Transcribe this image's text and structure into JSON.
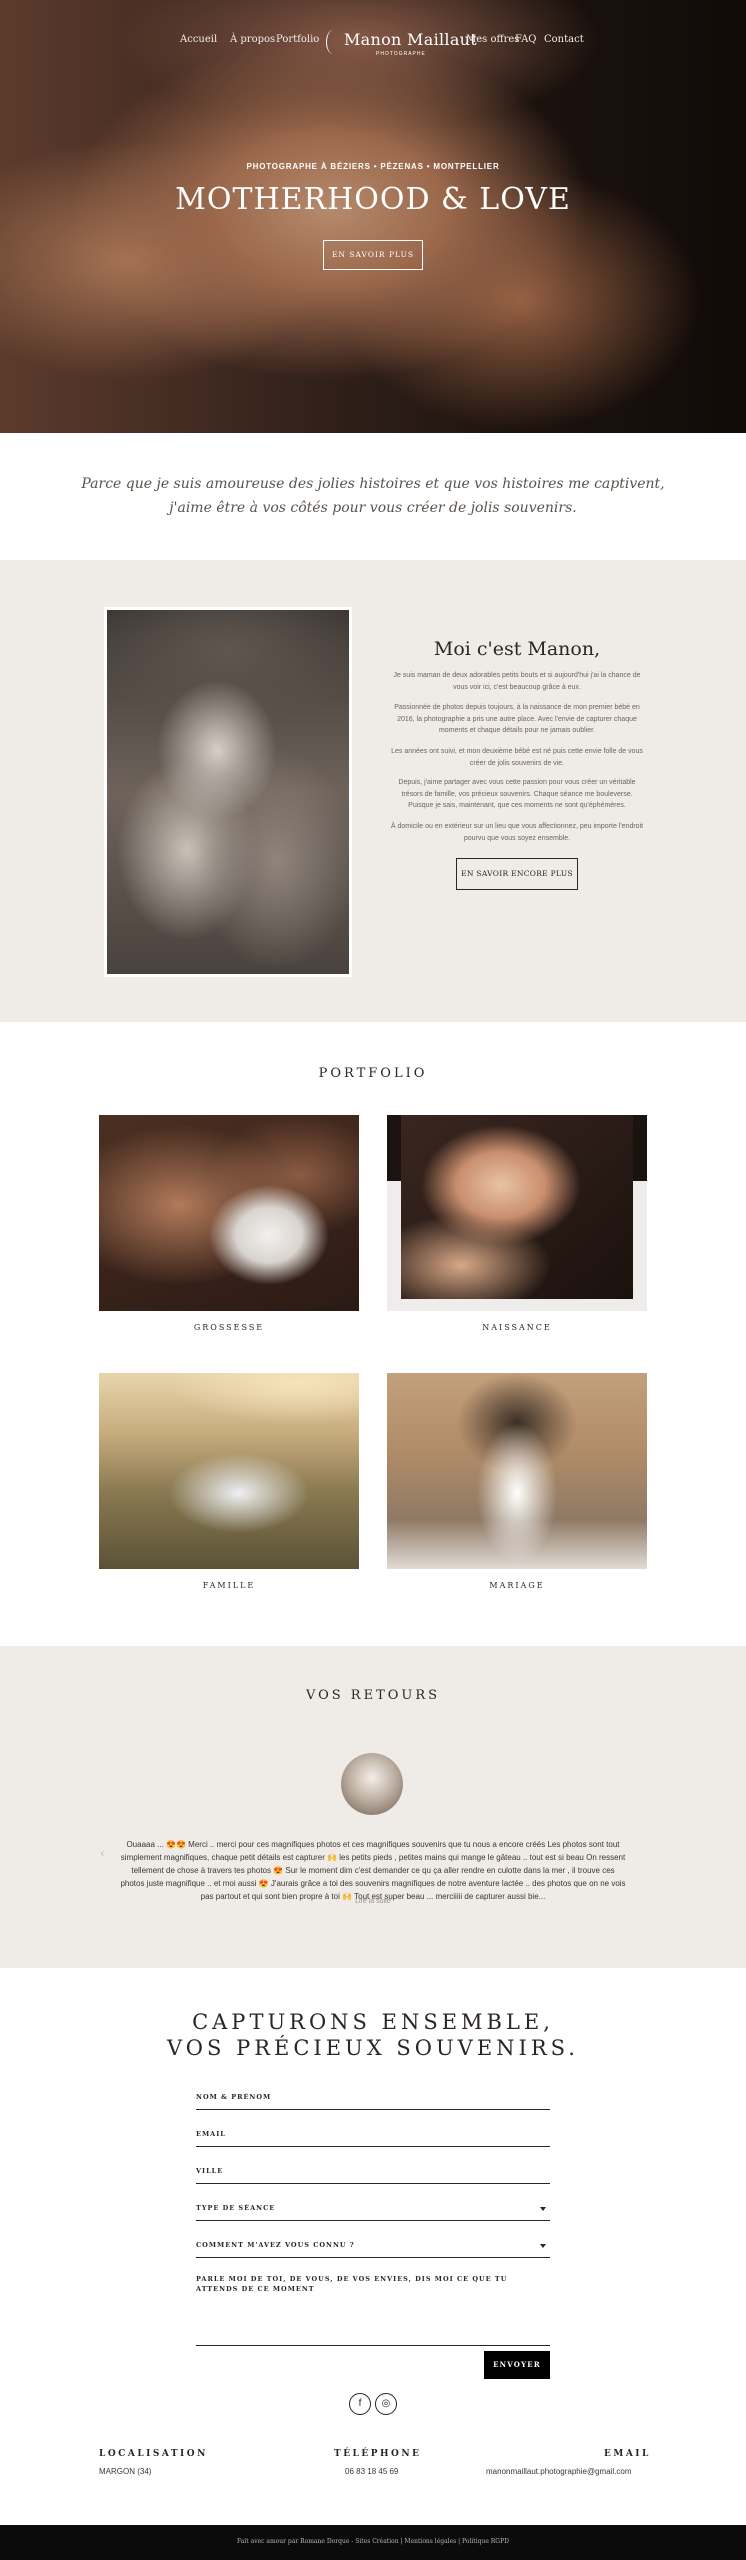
{
  "nav": {
    "items": [
      "Accueil",
      "À propos",
      "Portfolio",
      "Mes offres",
      "FAQ",
      "Contact"
    ],
    "logo_name": "Manon Maillaut",
    "logo_sub": "PHOTOGRAPHE"
  },
  "hero": {
    "kicker": "PHOTOGRAPHE À BÉZIERS • PÉZENAS • MONTPELLIER",
    "title": "MOTHERHOOD & LOVE",
    "button": "EN SAVOIR PLUS"
  },
  "quote": {
    "line1": "Parce que je suis amoureuse des jolies histoires et que vos histoires me captivent,",
    "line2": "j'aime être à vos côtés pour vous créer de jolis souvenirs."
  },
  "about": {
    "title": "Moi c'est Manon,",
    "p1": "Je suis maman de deux adorables petits bouts et si aujourd'hui j'ai la chance de vous voir ici, c'est beaucoup grâce à eux.",
    "p2": "Passionnée de photos depuis toujours, à la naissance de mon premier bébé en 2016, la photographie a pris une autre place. Avec l'envie de capturer chaque moments et chaque détails pour ne jamais oublier.",
    "p3": "Les années ont suivi, et mon deuxième bébé est né puis cette envie folle de vous créer de jolis souvenirs de vie.",
    "p4": "Depuis, j'aime partager avec vous cette passion pour vous créer un véritable trésors de famille, vos précieux souvenirs. Chaque séance me bouleverse. Puisque je sais, maintenant, que ces moments ne sont qu'éphémères.",
    "p5": "À domicile ou en extérieur sur un lieu que vous affectionnez, peu importe l'endroit pourvu que vous soyez ensemble.",
    "button": "EN SAVOIR ENCORE PLUS"
  },
  "portfolio": {
    "title": "PORTFOLIO",
    "items": [
      "GROSSESSE",
      "NAISSANCE",
      "FAMILLE",
      "MARIAGE"
    ]
  },
  "reviews": {
    "title": "VOS RETOURS",
    "text": "Ouaaaa ... 😍😍 Merci .. merci pour ces magnifiques photos et ces magnifiques souvenirs que tu nous a encore créés Les photos sont tout simplement magnifiques, chaque petit détails est capturer 🙌 les petits pieds , petites mains qui mange le gâteau .. tout est si beau On ressent tellement de chose à travers tes photos 😍 Sur le moment dim c'est demander ce qu ça aller rendre en culotte dans la mer , il trouve ces photos juste magnifique .. et moi aussi 😍 J'aurais grâce a toi des souvenirs magnifiques de notre aventure lactée .. des photos que on ne vois pas partout et qui sont bien propre à toi 🙌 Tout est super beau ... merciiiii de capturer aussi bie...",
    "more": "Lire la suite",
    "prev": "‹"
  },
  "contact": {
    "title1": "CAPTURONS ENSEMBLE,",
    "title2": "VOS PRÉCIEUX SOUVENIRS.",
    "fields": [
      "NOM & PRÉNOM",
      "EMAIL",
      "VILLE",
      "TYPE DE SÉANCE",
      "COMMENT M'AVEZ VOUS CONNU ?"
    ],
    "message_label": "PARLE MOI DE TOI, DE VOUS, DE VOS ENVIES, DIS MOI CE QUE TU ATTENDS DE CE MOMENT",
    "send": "ENVOYER"
  },
  "social": {
    "facebook": "f",
    "instagram": "◎"
  },
  "footer": {
    "loc_h": "LOCALISATION",
    "loc_v": "MARGON (34)",
    "tel_h": "TÉLÉPHONE",
    "tel_v": "06 83 18 45 69",
    "mail_h": "EMAIL",
    "mail_v": "manonmaillaut.photographie@gmail.com",
    "bottom": "Fait avec amour par Romane Dorque - Sites Création | Mentions légales | Politique RGPD"
  },
  "colors": {
    "beige": "#efebe6",
    "dark": "#2b2623",
    "black": "#0b0b0b"
  }
}
